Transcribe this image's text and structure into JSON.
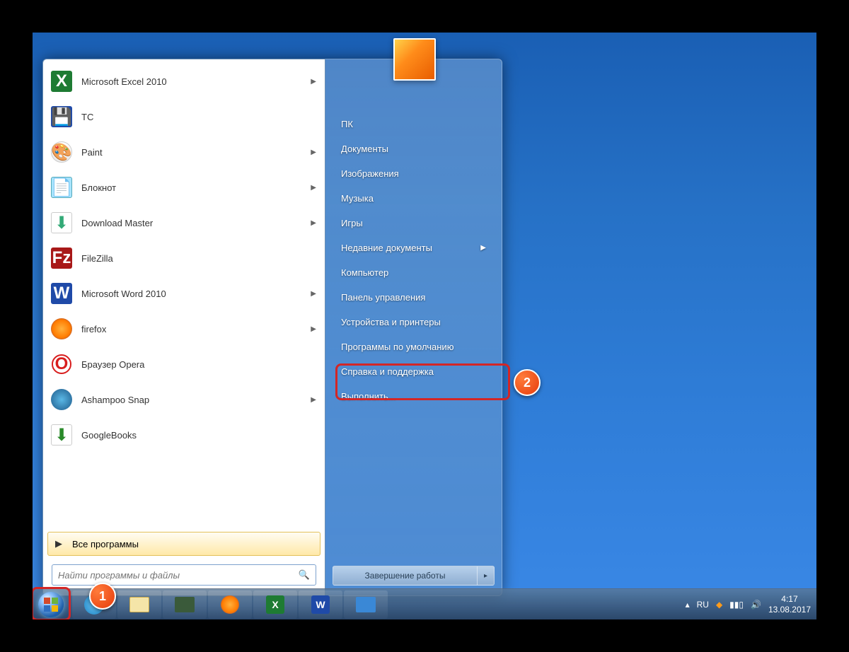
{
  "programs": [
    {
      "label": "Microsoft Excel 2010",
      "icon": "excel",
      "has_submenu": true
    },
    {
      "label": "TC",
      "icon": "tc",
      "has_submenu": false
    },
    {
      "label": "Paint",
      "icon": "paint",
      "has_submenu": true
    },
    {
      "label": "Блокнот",
      "icon": "notepad",
      "has_submenu": true
    },
    {
      "label": "Download Master",
      "icon": "dm",
      "has_submenu": true
    },
    {
      "label": "FileZilla",
      "icon": "filezilla",
      "has_submenu": false
    },
    {
      "label": "Microsoft Word 2010",
      "icon": "word",
      "has_submenu": true
    },
    {
      "label": "firefox",
      "icon": "firefox",
      "has_submenu": true
    },
    {
      "label": "Браузер Opera",
      "icon": "opera",
      "has_submenu": false
    },
    {
      "label": "Ashampoo Snap",
      "icon": "snap",
      "has_submenu": true
    },
    {
      "label": "GoogleBooks",
      "icon": "gbooks",
      "has_submenu": false
    }
  ],
  "all_programs_label": "Все программы",
  "search_placeholder": "Найти программы и файлы",
  "right_items": [
    {
      "label": "ПК",
      "has_submenu": false
    },
    {
      "label": "Документы",
      "has_submenu": false
    },
    {
      "label": "Изображения",
      "has_submenu": false
    },
    {
      "label": "Музыка",
      "has_submenu": false
    },
    {
      "label": "Игры",
      "has_submenu": false
    },
    {
      "label": "Недавние документы",
      "has_submenu": true
    },
    {
      "label": "Компьютер",
      "has_submenu": false
    },
    {
      "label": "Панель управления",
      "has_submenu": false
    },
    {
      "label": "Устройства и принтеры",
      "has_submenu": false
    },
    {
      "label": "Программы по умолчанию",
      "has_submenu": false
    },
    {
      "label": "Справка и поддержка",
      "has_submenu": false
    },
    {
      "label": "Выполнить...",
      "has_submenu": false
    }
  ],
  "shutdown_label": "Завершение работы",
  "tray": {
    "lang": "RU",
    "time": "4:17",
    "date": "13.08.2017"
  },
  "annotations": {
    "badge1": "1",
    "badge2": "2"
  }
}
